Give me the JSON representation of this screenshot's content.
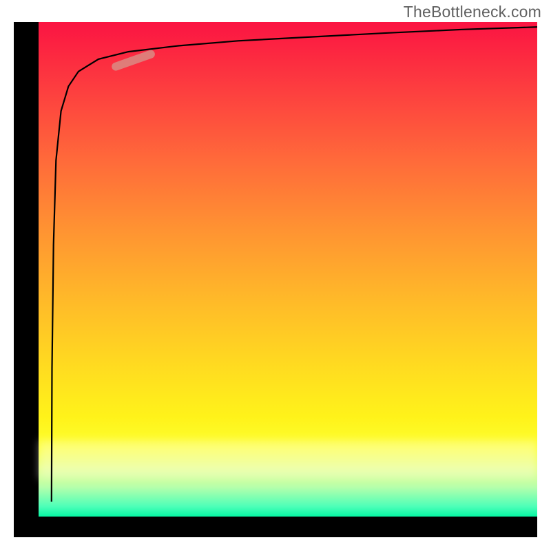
{
  "attribution": "TheBottleneck.com",
  "colors": {
    "frame": "#000000",
    "marker": "#d98b84",
    "gradient_top": "#fb1442",
    "gradient_bottom": "#06f7a3"
  },
  "chart_data": {
    "type": "line",
    "title": "",
    "xlabel": "",
    "ylabel": "",
    "xlim": [
      0,
      100
    ],
    "ylim": [
      0,
      100
    ],
    "grid": false,
    "legend": false,
    "background": "vertical-gradient red→yellow→green",
    "series": [
      {
        "name": "curve",
        "comment": "Approximate logarithmic-shaped curve: starts at bottom-left, rises very steeply, then flattens toward top-right. Values are fraction-of-plot estimates read from the image (0=left/bottom, 100=right/top).",
        "x": [
          2.6,
          2.7,
          3.0,
          3.5,
          4.5,
          6.0,
          8.0,
          12.0,
          18.0,
          28.0,
          40.0,
          55.0,
          70.0,
          85.0,
          100.0
        ],
        "y": [
          3.0,
          30.0,
          55.0,
          72.0,
          82.0,
          87.0,
          90.0,
          92.5,
          94.0,
          95.2,
          96.2,
          97.0,
          97.8,
          98.5,
          99.0
        ]
      }
    ],
    "annotations": [
      {
        "name": "highlight-marker",
        "comment": "Short pink capsule segment highlighting a portion of the curve near upper-left.",
        "x_range": [
          15.5,
          22.5
        ],
        "y_range": [
          91.0,
          93.5
        ]
      }
    ]
  }
}
